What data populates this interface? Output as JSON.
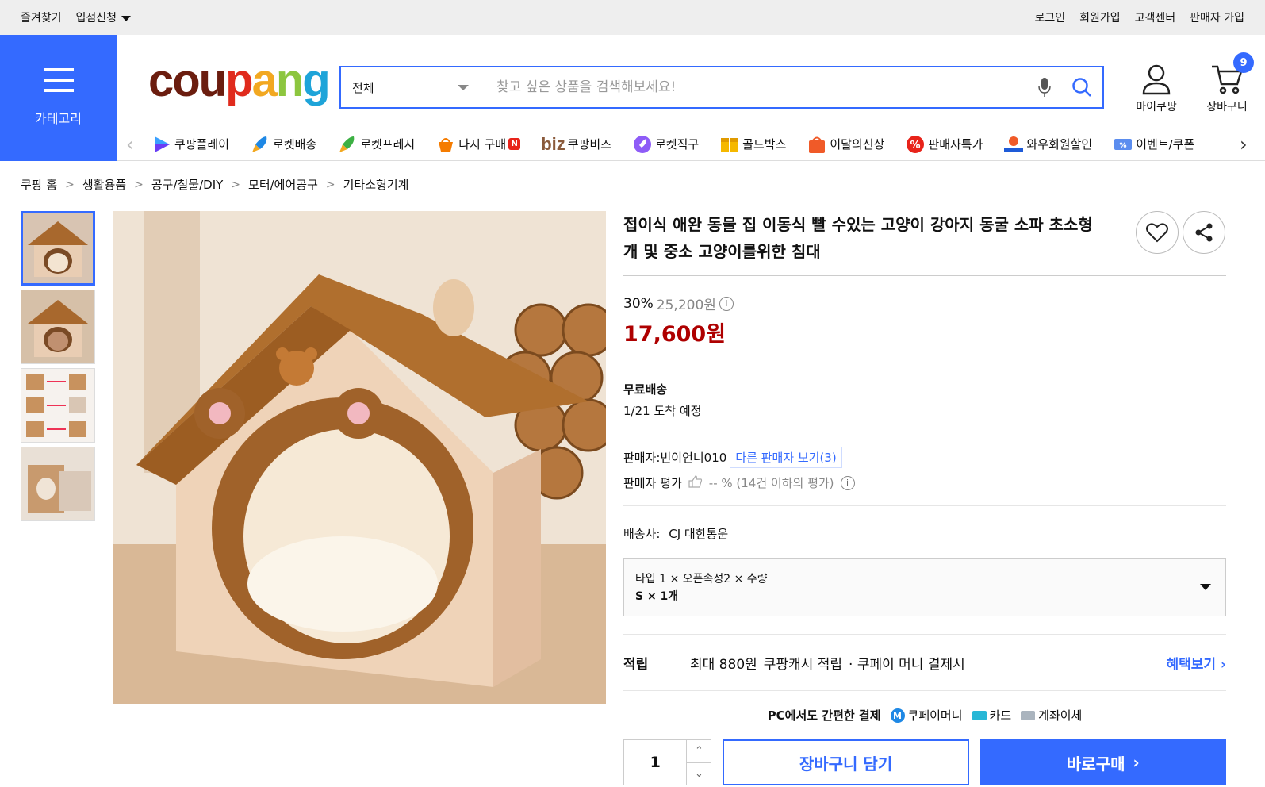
{
  "topbar": {
    "left": [
      "즐겨찾기",
      "입점신청"
    ],
    "right": [
      "로그인",
      "회원가입",
      "고객센터",
      "판매자 가입"
    ]
  },
  "category_button": {
    "label": "카테고리"
  },
  "logo": {
    "text": "coupang",
    "parts": [
      "cou",
      "p",
      "a",
      "n",
      "g"
    ]
  },
  "search": {
    "scope": "전체",
    "placeholder": "찾고 싶은 상품을 검색해보세요!"
  },
  "header_actions": {
    "mycoupang": "마이쿠팡",
    "cart": "장바구니",
    "cart_count": "9"
  },
  "nav": [
    {
      "label": "쿠팡플레이",
      "icon": "play-icon"
    },
    {
      "label": "로켓배송",
      "icon": "rocket-icon"
    },
    {
      "label": "로켓프레시",
      "icon": "rocket-fresh-icon"
    },
    {
      "label": "다시 구매",
      "icon": "basket-icon",
      "badge": "N"
    },
    {
      "label": "쿠팡비즈",
      "icon": "biz-icon",
      "prefix": "biz"
    },
    {
      "label": "로켓직구",
      "icon": "rocket-global-icon"
    },
    {
      "label": "골드박스",
      "icon": "goldbox-icon"
    },
    {
      "label": "이달의신상",
      "icon": "new-bag-icon"
    },
    {
      "label": "판매자특가",
      "icon": "percent-icon"
    },
    {
      "label": "와우회원할인",
      "icon": "wow-icon"
    },
    {
      "label": "이벤트/쿠폰",
      "icon": "coupon-icon"
    }
  ],
  "breadcrumb": [
    "쿠팡 홈",
    "생활용품",
    "공구/철물/DIY",
    "모터/에어공구",
    "기타소형기계"
  ],
  "product": {
    "title": "접이식 애완 동물 집 이동식 빨 수있는 고양이 강아지 동굴 소파 초소형 개 및 중소 고양이를위한 침대",
    "discount_rate": "30%",
    "original_price": "25,200원",
    "price": "17,600원",
    "shipping_label": "무료배송",
    "arrival": "1/21 도착 예정",
    "seller_label": "판매자:",
    "seller": "빈이언니010",
    "other_sellers": "다른 판매자 보기(3)",
    "seller_rating_label": "판매자 평가",
    "seller_rating": "-- % (14건 이하의 평가)",
    "courier_label": "배송사:",
    "courier": "CJ 대한통운",
    "option_line1": "타입 1 × 오픈속성2 × 수량",
    "option_line2": "S × 1개",
    "reward_label": "적립",
    "reward_amount": "최대 880원",
    "reward_link": "쿠팡캐시 적립",
    "reward_suffix": "· 쿠페이 머니 결제시",
    "benefit_link": "혜택보기",
    "pay_title": "PC에서도 간편한 결제",
    "pay_methods": [
      "쿠페이머니",
      "카드",
      "계좌이체"
    ],
    "quantity": "1",
    "add_to_cart": "장바구니 담기",
    "buy_now": "바로구매"
  },
  "colors": {
    "brand_blue": "#346aff",
    "price_red": "#ae0000"
  }
}
